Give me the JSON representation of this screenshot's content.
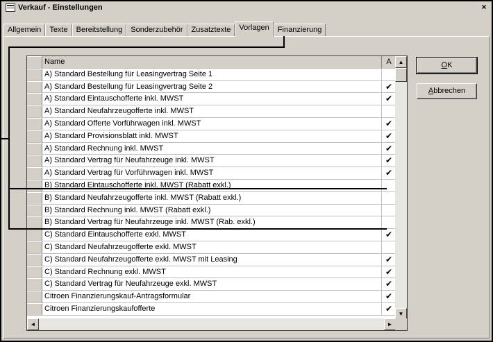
{
  "window": {
    "title": "Verkauf - Einstellungen",
    "close_glyph": "×"
  },
  "tabs": [
    {
      "label": "Allgemein",
      "active": false
    },
    {
      "label": "Texte",
      "active": false
    },
    {
      "label": "Bereitstellung",
      "active": false
    },
    {
      "label": "Sonderzubehör",
      "active": false
    },
    {
      "label": "Zusatztexte",
      "active": false
    },
    {
      "label": "Vorlagen",
      "active": true
    },
    {
      "label": "Finanzierung",
      "active": false
    }
  ],
  "grid": {
    "columns": {
      "name": "Name",
      "a": "A"
    },
    "rows": [
      {
        "name": "A) Standard Bestellung für Leasingvertrag Seite 1",
        "checked": false
      },
      {
        "name": "A) Standard Bestellung für Leasingvertrag Seite 2",
        "checked": true
      },
      {
        "name": "A) Standard Eintauschofferte inkl. MWST",
        "checked": true
      },
      {
        "name": "A) Standard Neufahrzeugofferte inkl. MWST",
        "checked": false
      },
      {
        "name": "A) Standard Offerte Vorführwagen inkl. MWST",
        "checked": true
      },
      {
        "name": "A) Standard Provisionsblatt inkl. MWST",
        "checked": true
      },
      {
        "name": "A) Standard Rechnung inkl. MWST",
        "checked": true
      },
      {
        "name": "A) Standard Vertrag für Neufahrzeuge inkl. MWST",
        "checked": true
      },
      {
        "name": "A) Standard Vertrag für Vorführwagen inkl. MWST",
        "checked": true
      },
      {
        "name": "B) Standard Eintauschofferte inkl. MWST (Rabatt exkl.)",
        "checked": false
      },
      {
        "name": "B) Standard Neufahrzeugofferte inkl. MWST (Rabatt exkl.)",
        "checked": false
      },
      {
        "name": "B) Standard Rechnung inkl. MWST (Rabatt exkl.)",
        "checked": false
      },
      {
        "name": "B) Standard Vertrag für Neufahrzeuge inkl. MWST (Rab. exkl.)",
        "checked": false
      },
      {
        "name": "C) Standard Eintauschofferte exkl. MWST",
        "checked": true
      },
      {
        "name": "C) Standard Neufahrzeugofferte exkl. MWST",
        "checked": false
      },
      {
        "name": "C) Standard Neufahrzeugofferte exkl. MWST mit Leasing",
        "checked": true
      },
      {
        "name": "C) Standard Rechnung exkl. MWST",
        "checked": true
      },
      {
        "name": "C) Standard Vertrag für Neufahrzeuge exkl. MWST",
        "checked": true
      },
      {
        "name": "Citroen Finanzierungskauf-Antragsformular",
        "checked": true
      },
      {
        "name": "Citroen Finanzierungskaufofferte",
        "checked": true
      }
    ],
    "check_glyph": "✔"
  },
  "buttons": {
    "ok": {
      "accel": "O",
      "rest": "K"
    },
    "cancel": {
      "accel": "A",
      "rest": "bbrechen"
    }
  },
  "scroll_glyphs": {
    "up": "▲",
    "down": "▼",
    "left": "◄",
    "right": "►"
  }
}
